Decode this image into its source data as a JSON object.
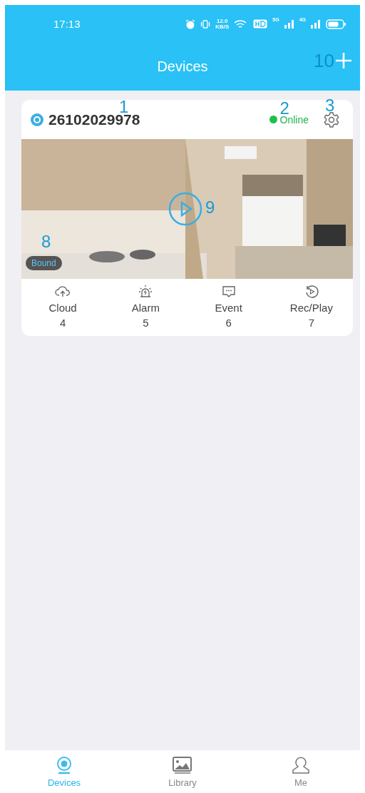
{
  "status_bar": {
    "time": "17:13",
    "speed": "12.0",
    "speed_unit": "KB/S",
    "network_1": "5G",
    "network_2": "4G"
  },
  "header": {
    "title": "Devices",
    "add_marker": "10"
  },
  "device": {
    "id": "26102029978",
    "id_marker": "1",
    "status": "Online",
    "online": true,
    "status_marker": "2",
    "settings_marker": "3",
    "badge": "Bound",
    "badge_marker": "8",
    "play_marker": "9",
    "actions": [
      {
        "kind": "cloud",
        "label": "Cloud",
        "marker": "4"
      },
      {
        "kind": "alarm",
        "label": "Alarm",
        "marker": "5"
      },
      {
        "kind": "event",
        "label": "Event",
        "marker": "6"
      },
      {
        "kind": "playback",
        "label": "Rec/Play",
        "marker": "7"
      }
    ]
  },
  "tabs": [
    {
      "kind": "devices",
      "label": "Devices",
      "selected": true
    },
    {
      "kind": "library",
      "label": "Library",
      "selected": false
    },
    {
      "kind": "me",
      "label": "Me",
      "selected": false
    }
  ]
}
